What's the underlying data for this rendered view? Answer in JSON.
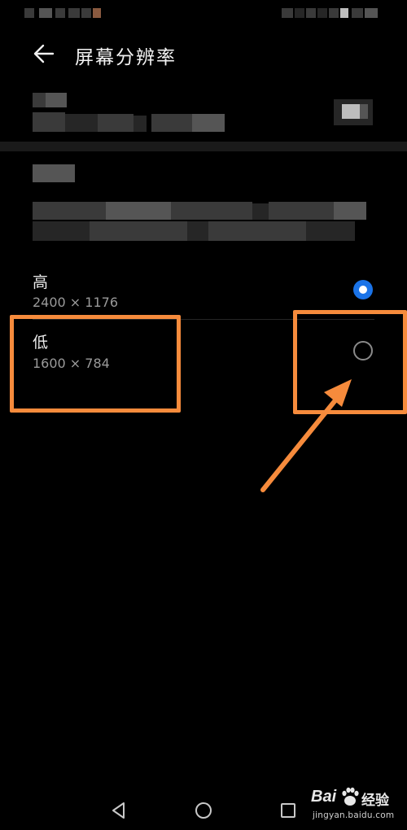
{
  "header": {
    "title": "屏幕分辨率"
  },
  "options": [
    {
      "label": "高",
      "resolution": "2400 × 1176",
      "selected": true
    },
    {
      "label": "低",
      "resolution": "1600 × 784",
      "selected": false
    }
  ],
  "watermark": {
    "brand": "Bai",
    "brand_suffix": "经验",
    "url": "jingyan.baidu.com"
  },
  "colors": {
    "accent": "#1a73e8",
    "annotation": "#f68b3c"
  },
  "icons": {
    "back": "arrow-left-icon",
    "nav_back": "triangle-back-icon",
    "nav_home": "circle-home-icon",
    "nav_recent": "square-recents-icon"
  }
}
